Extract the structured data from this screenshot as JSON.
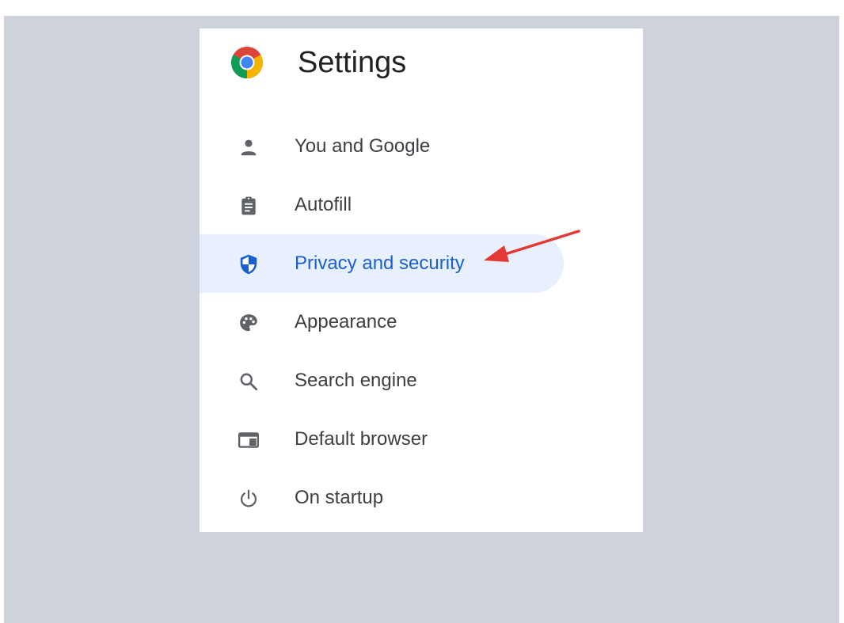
{
  "settings": {
    "title": "Settings",
    "logo_icon": "chrome-logo-icon",
    "active_item": "Privacy and security",
    "colors": {
      "background": "#ced3db",
      "panel": "#ffffff",
      "active_highlight": "#e8f0fe",
      "active_text": "#1a5fd0",
      "text": "#3c4043",
      "annotation_arrow": "#e53935"
    },
    "items": [
      {
        "label": "You and Google",
        "icon": "person-icon"
      },
      {
        "label": "Autofill",
        "icon": "clipboard-icon"
      },
      {
        "label": "Privacy and security",
        "icon": "shield-icon"
      },
      {
        "label": "Appearance",
        "icon": "palette-icon"
      },
      {
        "label": "Search engine",
        "icon": "search-icon"
      },
      {
        "label": "Default browser",
        "icon": "browser-window-icon"
      },
      {
        "label": "On startup",
        "icon": "power-icon"
      }
    ]
  }
}
